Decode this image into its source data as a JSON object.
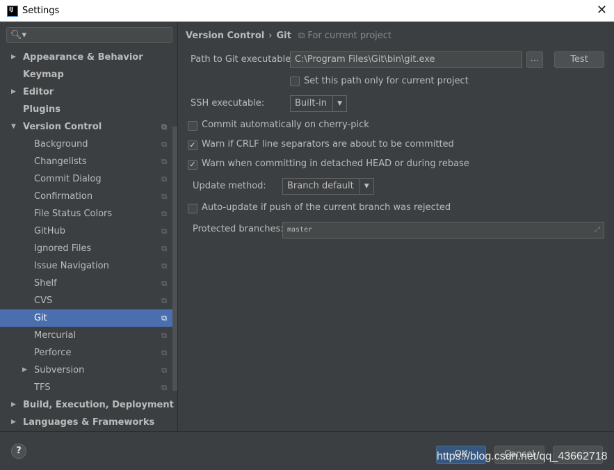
{
  "window": {
    "title": "Settings",
    "close": "✕",
    "logo": "IJ"
  },
  "search": {
    "icon": "search-icon",
    "value": ""
  },
  "sidebar": {
    "items": [
      {
        "label": "Appearance & Behavior",
        "level": 0,
        "expandable": true,
        "expanded": false
      },
      {
        "label": "Keymap",
        "level": 0
      },
      {
        "label": "Editor",
        "level": 0,
        "expandable": true,
        "expanded": false
      },
      {
        "label": "Plugins",
        "level": 0
      },
      {
        "label": "Version Control",
        "level": 0,
        "expandable": true,
        "expanded": true,
        "project": true
      },
      {
        "label": "Background",
        "level": 1,
        "project": true
      },
      {
        "label": "Changelists",
        "level": 1,
        "project": true
      },
      {
        "label": "Commit Dialog",
        "level": 1,
        "project": true
      },
      {
        "label": "Confirmation",
        "level": 1,
        "project": true
      },
      {
        "label": "File Status Colors",
        "level": 1,
        "project": true
      },
      {
        "label": "GitHub",
        "level": 1,
        "project": true
      },
      {
        "label": "Ignored Files",
        "level": 1,
        "project": true
      },
      {
        "label": "Issue Navigation",
        "level": 1,
        "project": true
      },
      {
        "label": "Shelf",
        "level": 1,
        "project": true
      },
      {
        "label": "CVS",
        "level": 1,
        "project": true
      },
      {
        "label": "Git",
        "level": 1,
        "project": true,
        "selected": true
      },
      {
        "label": "Mercurial",
        "level": 1,
        "project": true
      },
      {
        "label": "Perforce",
        "level": 1,
        "project": true
      },
      {
        "label": "Subversion",
        "level": 1,
        "expandable": true,
        "project": true
      },
      {
        "label": "TFS",
        "level": 1,
        "project": true
      },
      {
        "label": "Build, Execution, Deployment",
        "level": 0,
        "expandable": true
      },
      {
        "label": "Languages & Frameworks",
        "level": 0,
        "expandable": true
      }
    ]
  },
  "breadcrumb": {
    "parent": "Version Control",
    "sep": "›",
    "current": "Git",
    "scope": "For current project"
  },
  "git": {
    "path_label": "Path to Git executable:",
    "path_value": "C:\\Program Files\\Git\\bin\\git.exe",
    "browse": "...",
    "test": "Test",
    "path_only_project": {
      "label": "Set this path only for current project",
      "checked": false
    },
    "ssh_label": "SSH executable:",
    "ssh_value": "Built-in",
    "cherry_pick": {
      "label": "Commit automatically on cherry-pick",
      "checked": false
    },
    "crlf": {
      "label": "Warn if CRLF line separators are about to be committed",
      "checked": true
    },
    "detached": {
      "label": "Warn when committing in detached HEAD or during rebase",
      "checked": true
    },
    "update_label": "Update method:",
    "update_value": "Branch default",
    "auto_update": {
      "label": "Auto-update if push of the current branch was rejected",
      "checked": false
    },
    "protected_label": "Protected branches:",
    "protected_value": "master"
  },
  "footer": {
    "help": "?",
    "ok": "OK",
    "cancel": "Cancel",
    "apply": "Apply",
    "watermark": "https://blog.csdn.net/qq_43662718"
  },
  "colors": {
    "selection": "#4b6eaf",
    "background": "#3c3f41",
    "ok_button": "#365880"
  }
}
